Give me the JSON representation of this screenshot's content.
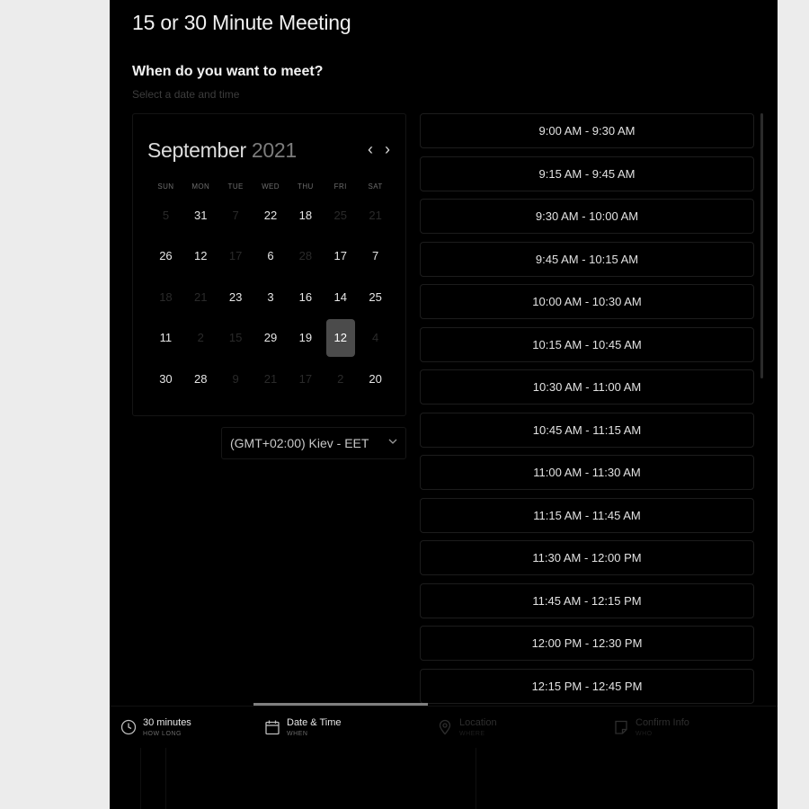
{
  "meeting": {
    "title": "15 or 30 Minute Meeting",
    "question": "When do you want to meet?",
    "subtitle": "Select a date and time"
  },
  "calendar": {
    "month": "September",
    "year": "2021",
    "prev_label": "‹",
    "next_label": "›",
    "weekdays": [
      "SUN",
      "MON",
      "TUE",
      "WED",
      "THU",
      "FRI",
      "SAT"
    ],
    "weeks": [
      [
        {
          "d": "5",
          "dim": true
        },
        {
          "d": "31",
          "dim": false
        },
        {
          "d": "7",
          "dim": true
        },
        {
          "d": "22",
          "dim": false
        },
        {
          "d": "18",
          "dim": false
        },
        {
          "d": "25",
          "dim": true
        },
        {
          "d": "21",
          "dim": true
        }
      ],
      [
        {
          "d": "26",
          "dim": false
        },
        {
          "d": "12",
          "dim": false
        },
        {
          "d": "17",
          "dim": true
        },
        {
          "d": "6",
          "dim": false
        },
        {
          "d": "28",
          "dim": true
        },
        {
          "d": "17",
          "dim": false
        },
        {
          "d": "7",
          "dim": false
        }
      ],
      [
        {
          "d": "18",
          "dim": true
        },
        {
          "d": "21",
          "dim": true
        },
        {
          "d": "23",
          "dim": false
        },
        {
          "d": "3",
          "dim": false
        },
        {
          "d": "16",
          "dim": false
        },
        {
          "d": "14",
          "dim": false
        },
        {
          "d": "25",
          "dim": false
        }
      ],
      [
        {
          "d": "11",
          "dim": false
        },
        {
          "d": "2",
          "dim": true
        },
        {
          "d": "15",
          "dim": true
        },
        {
          "d": "29",
          "dim": false
        },
        {
          "d": "19",
          "dim": false
        },
        {
          "d": "12",
          "dim": false,
          "selected": true
        },
        {
          "d": "4",
          "dim": true
        }
      ],
      [
        {
          "d": "30",
          "dim": false
        },
        {
          "d": "28",
          "dim": false
        },
        {
          "d": "9",
          "dim": true
        },
        {
          "d": "21",
          "dim": true
        },
        {
          "d": "17",
          "dim": true
        },
        {
          "d": "2",
          "dim": true
        },
        {
          "d": "20",
          "dim": false
        }
      ]
    ]
  },
  "timezone": {
    "value": "(GMT+02:00) Kiev - EET"
  },
  "time_slots": [
    "9:00 AM - 9:30 AM",
    "9:15 AM - 9:45 AM",
    "9:30 AM - 10:00 AM",
    "9:45 AM - 10:15 AM",
    "10:00 AM - 10:30 AM",
    "10:15 AM - 10:45 AM",
    "10:30 AM - 11:00 AM",
    "10:45 AM - 11:15 AM",
    "11:00 AM - 11:30 AM",
    "11:15 AM - 11:45 AM",
    "11:30 AM - 12:00 PM",
    "11:45 AM - 12:15 PM",
    "12:00 PM - 12:30 PM",
    "12:15 PM - 12:45 PM"
  ],
  "steps": [
    {
      "label": "30 minutes",
      "sub": "HOW LONG",
      "icon": "clock-icon",
      "active": true
    },
    {
      "label": "Date & Time",
      "sub": "WHEN",
      "icon": "calendar-icon",
      "active": true
    },
    {
      "label": "Location",
      "sub": "WHERE",
      "icon": "location-pin-icon",
      "active": false
    },
    {
      "label": "Confirm Info",
      "sub": "WHO",
      "icon": "note-icon",
      "active": false
    }
  ],
  "colors": {
    "background": "#000000",
    "outer": "#ececec",
    "selected_day": "#4b4b4b",
    "progress": "#7f7f7f"
  }
}
